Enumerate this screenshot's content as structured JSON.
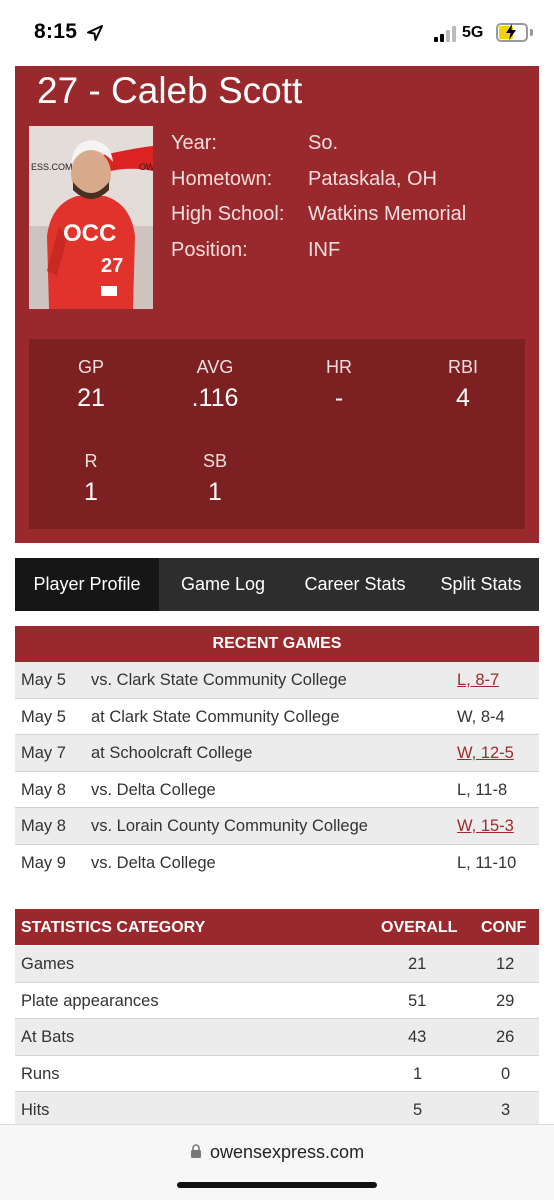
{
  "status_bar": {
    "time": "8:15",
    "network": "5G",
    "battery_level": 0.55
  },
  "player": {
    "title": "27 - Caleb Scott",
    "bio": [
      {
        "label": "Year:",
        "value": "So."
      },
      {
        "label": "Hometown:",
        "value": "Pataskala, OH"
      },
      {
        "label": "High School:",
        "value": "Watkins Memorial"
      },
      {
        "label": "Position:",
        "value": "INF"
      }
    ],
    "photo": {
      "jersey_text": "OCC",
      "number": "27",
      "backdrop_text_left": "ESS.COM",
      "backdrop_text_right": "OW"
    },
    "stats": [
      {
        "label": "GP",
        "value": "21"
      },
      {
        "label": "AVG",
        "value": ".116"
      },
      {
        "label": "HR",
        "value": "-"
      },
      {
        "label": "RBI",
        "value": "4"
      },
      {
        "label": "R",
        "value": "1"
      },
      {
        "label": "SB",
        "value": "1"
      }
    ]
  },
  "tabs": [
    {
      "label": "Player Profile",
      "active": true
    },
    {
      "label": "Game Log",
      "active": false
    },
    {
      "label": "Career Stats",
      "active": false
    },
    {
      "label": "Split Stats",
      "active": false
    }
  ],
  "recent_games": {
    "header": "RECENT GAMES",
    "rows": [
      {
        "date": "May 5",
        "opponent": "vs. Clark State Community College",
        "result": "L, 8-7",
        "link": true
      },
      {
        "date": "May 5",
        "opponent": "at Clark State Community College",
        "result": "W, 8-4",
        "link": false
      },
      {
        "date": "May 7",
        "opponent": "at Schoolcraft College",
        "result": "W, 12-5",
        "link": true
      },
      {
        "date": "May 8",
        "opponent": "vs. Delta College",
        "result": "L, 11-8",
        "link": false
      },
      {
        "date": "May 8",
        "opponent": "vs. Lorain County Community College",
        "result": "W, 15-3",
        "link": true
      },
      {
        "date": "May 9",
        "opponent": "vs. Delta College",
        "result": "L, 11-10",
        "link": false
      }
    ]
  },
  "stats_table": {
    "headers": {
      "category": "STATISTICS CATEGORY",
      "overall": "OVERALL",
      "conf": "CONF"
    },
    "rows": [
      {
        "category": "Games",
        "overall": "21",
        "conf": "12"
      },
      {
        "category": "Plate appearances",
        "overall": "51",
        "conf": "29"
      },
      {
        "category": "At Bats",
        "overall": "43",
        "conf": "26"
      },
      {
        "category": "Runs",
        "overall": "1",
        "conf": "0"
      },
      {
        "category": "Hits",
        "overall": "5",
        "conf": "3"
      }
    ]
  },
  "browser": {
    "url": "owensexpress.com"
  },
  "colors": {
    "brand": "#99292c",
    "brand_dark": "#7d2022",
    "tab_bg": "#2d2d2d",
    "tab_active": "#161616",
    "link": "#a02b2e"
  }
}
